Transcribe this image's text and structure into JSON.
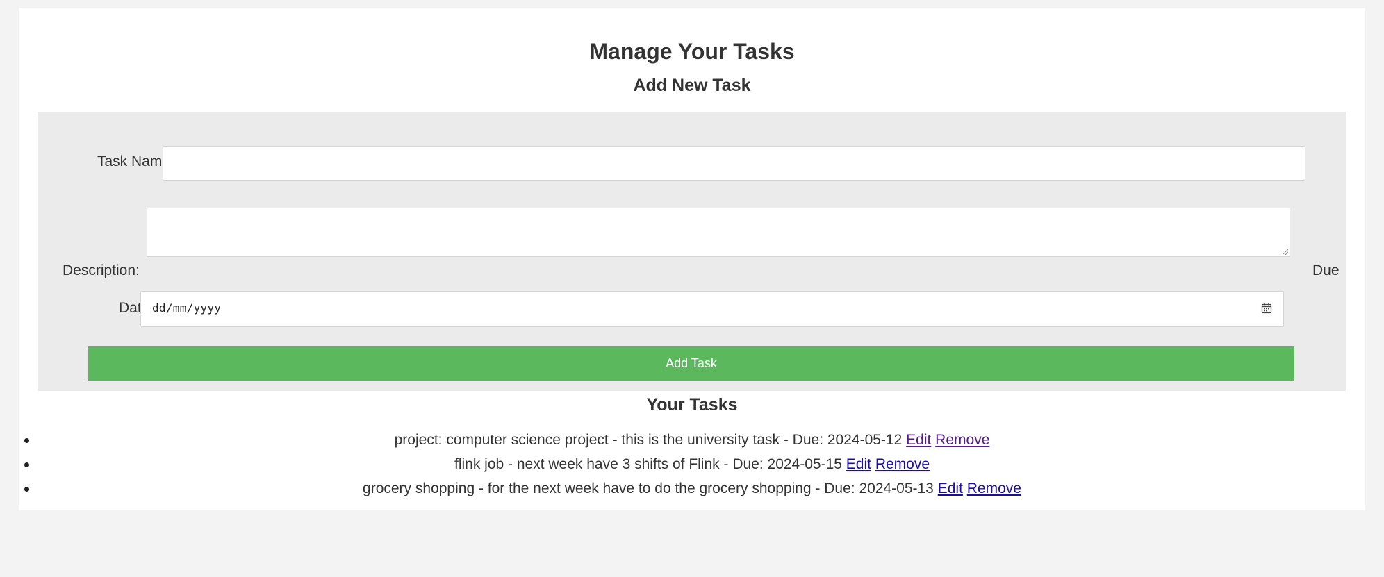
{
  "page": {
    "title": "Manage Your Tasks",
    "subtitle": "Add New Task"
  },
  "form": {
    "task_name_label": "Task Name:",
    "task_name_value": "",
    "description_label": "Description:",
    "description_value": "",
    "due_label_part1": "Due",
    "due_label_part2": "Date:",
    "date_placeholder": "dd/mm/yyyy",
    "submit_label": "Add Task"
  },
  "tasks": {
    "heading": "Your Tasks",
    "items": [
      {
        "text": "project: computer science project - this is the university task - Due: 2024-05-12",
        "edit": "Edit",
        "remove": "Remove",
        "links_visited": true
      },
      {
        "text": "flink job - next week have 3 shifts of Flink - Due: 2024-05-15",
        "edit": "Edit",
        "remove": "Remove",
        "links_visited": false
      },
      {
        "text": "grocery shopping - for the next week have to do the grocery shopping - Due: 2024-05-13",
        "edit": "Edit",
        "remove": "Remove",
        "links_visited": false
      }
    ]
  },
  "colors": {
    "page_bg": "#f3f3f3",
    "panel_bg": "#ebebeb",
    "button_bg": "#5cb85c",
    "link_visited": "#551a8b",
    "link": "#1a0dab"
  },
  "icons": {
    "calendar": "calendar-icon",
    "resize": "resize-grip-icon"
  }
}
